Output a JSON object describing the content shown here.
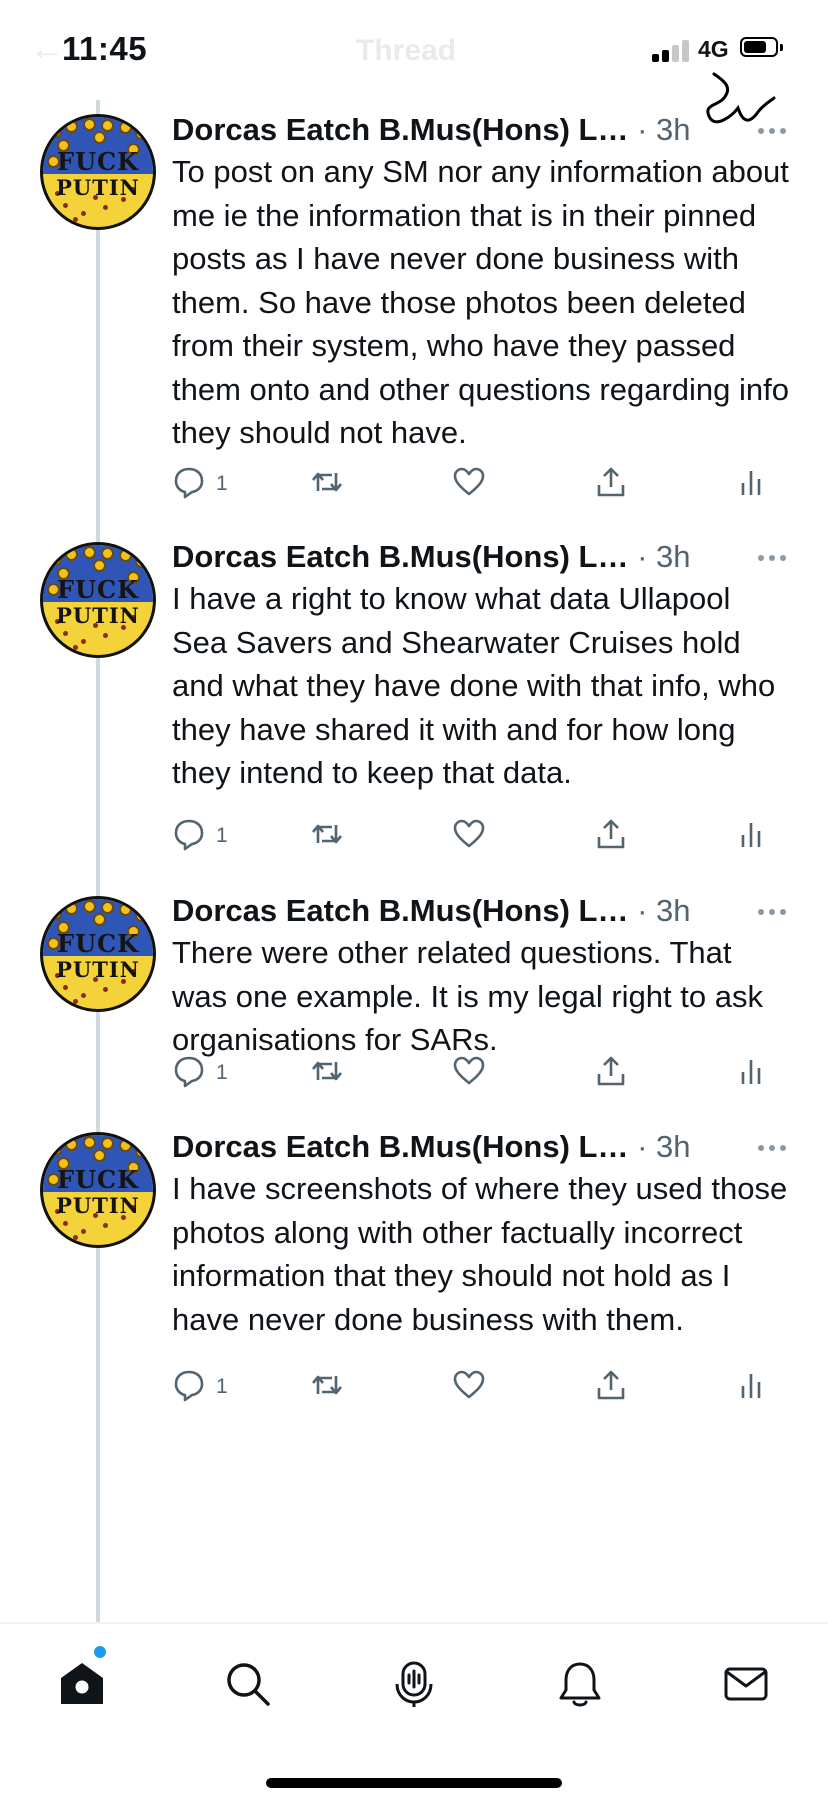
{
  "status_bar": {
    "time": "11:45",
    "network": "4G",
    "battery_level": 0.65
  },
  "header": {
    "back_icon": "back-arrow-icon",
    "title": "Thread"
  },
  "avatar": {
    "line1": "FUCK",
    "line2": "PUTIN",
    "colors": {
      "top": "#2f56b6",
      "bottom": "#f4d33a"
    }
  },
  "tweets": [
    {
      "name": "Dorcas Eatch B.Mus(Hons) L…",
      "meta": "· 3h",
      "text": "To post on any SM nor any information about me ie the information that is in their pinned posts as I have never done business with them. So have those photos been deleted from their system, who have they passed them onto and other questions regarding info they should not have.",
      "reply_count": "1"
    },
    {
      "name": "Dorcas Eatch B.Mus(Hons) L…",
      "meta": "· 3h",
      "text": "I have a right to know what data Ullapool Sea Savers and Shearwater Cruises hold and what they have done with that info, who they have shared it with and for how long they intend to keep that data.",
      "reply_count": "1"
    },
    {
      "name": "Dorcas Eatch B.Mus(Hons) L…",
      "meta": "· 3h",
      "text": "There were other related questions. That was one example. It is my legal right to ask organisations for SARs.",
      "reply_count": "1"
    },
    {
      "name": "Dorcas Eatch B.Mus(Hons) L…",
      "meta": "· 3h",
      "text": "I have screenshots of where they used those photos along with other factually incorrect information that they should not hold as I have never done business with them.",
      "reply_count": "1"
    }
  ],
  "tab_bar": {
    "items": [
      "home-icon",
      "search-icon",
      "spaces-icon",
      "notifications-icon",
      "messages-icon"
    ]
  },
  "colors": {
    "text": "#0f1419",
    "secondary": "#536471",
    "accent": "#1d9bf0",
    "thread_line": "#cfd9de"
  }
}
